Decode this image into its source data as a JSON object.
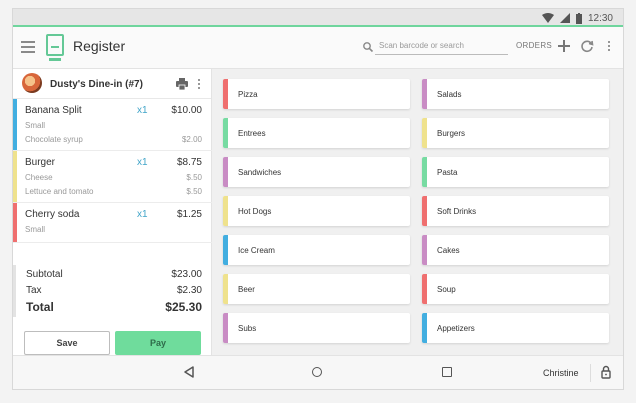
{
  "status": {
    "time": "12:30"
  },
  "app": {
    "title": "Register",
    "search_placeholder": "Scan barcode or search",
    "orders_label": "ORDERS"
  },
  "order": {
    "title": "Dusty's Dine-in (#7)",
    "items": [
      {
        "name": "Banana Split",
        "qty": "x1",
        "price": "$10.00",
        "color": "#42aee0",
        "mods": [
          {
            "name": "Small",
            "price": ""
          },
          {
            "name": "Chocolate syrup",
            "price": "$2.00"
          }
        ]
      },
      {
        "name": "Burger",
        "qty": "x1",
        "price": "$8.75",
        "color": "#efe28d",
        "mods": [
          {
            "name": "Cheese",
            "price": "$.50"
          },
          {
            "name": "Lettuce and tomato",
            "price": "$.50"
          }
        ]
      },
      {
        "name": "Cherry soda",
        "qty": "x1",
        "price": "$1.25",
        "color": "#ef6f6f",
        "mods": [
          {
            "name": "Small",
            "price": ""
          }
        ]
      }
    ],
    "subtotal_label": "Subtotal",
    "subtotal_value": "$23.00",
    "tax_label": "Tax",
    "tax_value": "$2.30",
    "total_label": "Total",
    "total_value": "$25.30",
    "save_label": "Save",
    "pay_label": "Pay"
  },
  "categories": [
    {
      "label": "Pizza",
      "color": "#ef6f6f"
    },
    {
      "label": "Salads",
      "color": "#c98cc4"
    },
    {
      "label": "Entrees",
      "color": "#77dba2"
    },
    {
      "label": "Burgers",
      "color": "#efe28d"
    },
    {
      "label": "Sandwiches",
      "color": "#c98cc4"
    },
    {
      "label": "Pasta",
      "color": "#77dba2"
    },
    {
      "label": "Hot Dogs",
      "color": "#efe28d"
    },
    {
      "label": "Soft Drinks",
      "color": "#ef6f6f"
    },
    {
      "label": "Ice Cream",
      "color": "#42aee0"
    },
    {
      "label": "Cakes",
      "color": "#c98cc4"
    },
    {
      "label": "Beer",
      "color": "#efe28d"
    },
    {
      "label": "Soup",
      "color": "#ef6f6f"
    },
    {
      "label": "Subs",
      "color": "#c98cc4"
    },
    {
      "label": "Appetizers",
      "color": "#42aee0"
    }
  ],
  "footer": {
    "user_name": "Christine"
  }
}
